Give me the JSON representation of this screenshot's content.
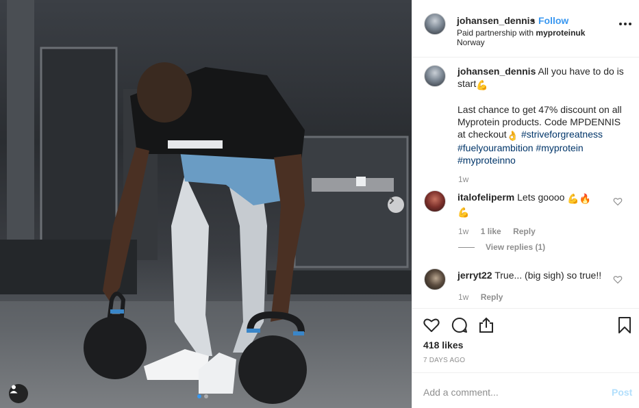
{
  "post_header": {
    "username": "johansen_dennis",
    "separator": "•",
    "follow_label": "Follow",
    "paid_prefix": "Paid partnership with ",
    "paid_partner": "myproteinuk",
    "location": "Norway"
  },
  "caption": {
    "username": "johansen_dennis",
    "line1": "All you have to do is start",
    "emoji1": "💪",
    "line2": "Last chance to get 47% discount on all Myprotein products. Code MPDENNIS at checkout",
    "emoji2": "👌",
    "tags": [
      "#striveforgreatness",
      "#fuelyourambition",
      "#myprotein",
      "#myproteinno"
    ],
    "time": "1w"
  },
  "comments": [
    {
      "username": "italofeliperm",
      "text": "Lets goooo",
      "emojis": "💪🔥",
      "emoji_line2": "💪",
      "time": "1w",
      "likes": "1 like",
      "reply": "Reply",
      "view_replies": "View replies (1)"
    },
    {
      "username": "jerryt22",
      "text": "True... (big sigh) so true!!",
      "time": "1w",
      "reply": "Reply"
    }
  ],
  "actions": {
    "likes": "418 likes",
    "posted_ago": "7 DAYS AGO"
  },
  "add_comment": {
    "placeholder": "Add a comment...",
    "post_label": "Post"
  },
  "carousel": {
    "slide_count": 2,
    "active_slide": 1
  },
  "colors": {
    "link": "#3897f0",
    "hashtag": "#003569",
    "muted": "#8e8e8e",
    "post_disabled": "#b2dffc"
  }
}
